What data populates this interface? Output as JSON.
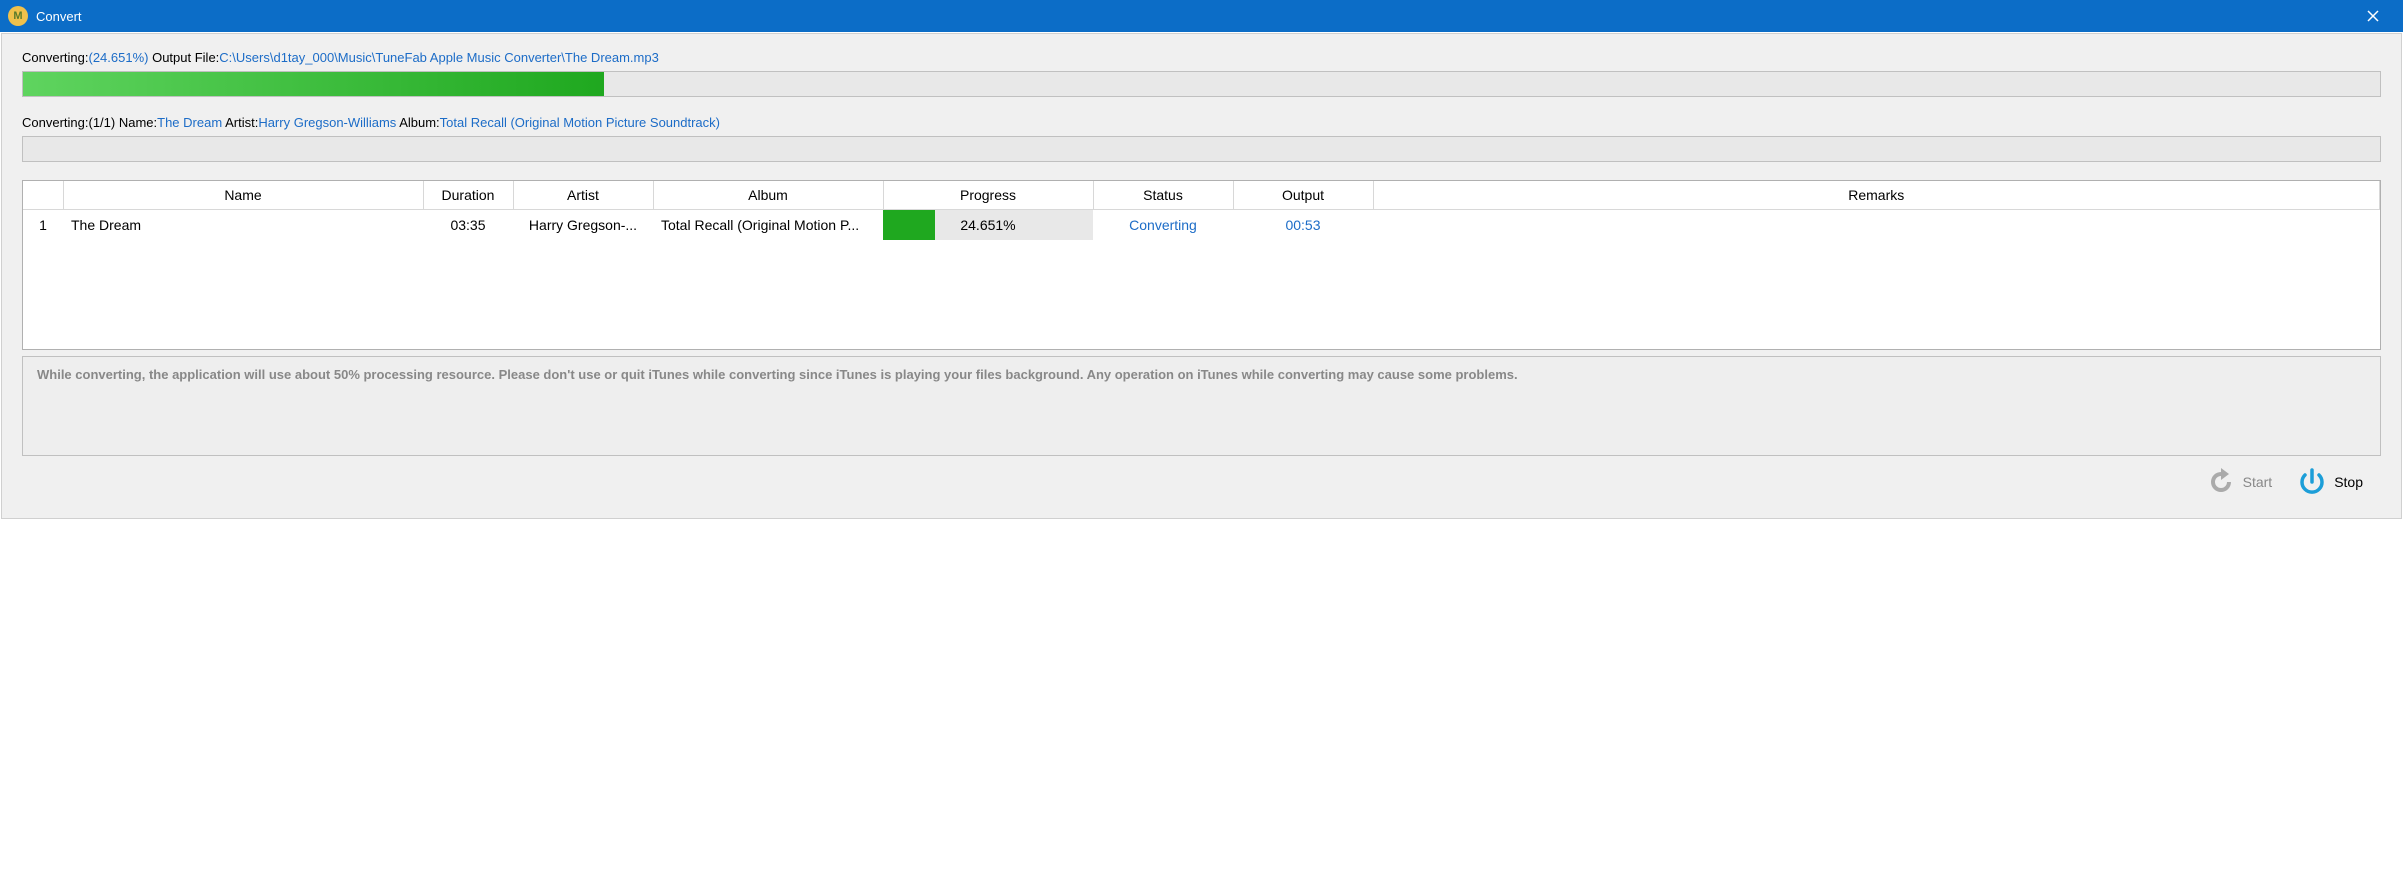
{
  "window": {
    "title": "Convert"
  },
  "top": {
    "label": "Converting:",
    "percent": "(24.651%)",
    "output_label": "Output File:",
    "output_file": "C:\\Users\\d1tay_000\\Music\\TuneFab Apple Music Converter\\The Dream.mp3",
    "progress_percent": 24.651
  },
  "track": {
    "label": "Converting:",
    "index": "(1/1)",
    "name_label": "Name:",
    "name": "The Dream",
    "artist_label": "Artist:",
    "artist": "Harry Gregson-Williams",
    "album_label": "Album:",
    "album": "Total Recall (Original Motion Picture Soundtrack)",
    "progress_percent": 0
  },
  "table": {
    "headers": {
      "idx": "",
      "name": "Name",
      "duration": "Duration",
      "artist": "Artist",
      "album": "Album",
      "progress": "Progress",
      "status": "Status",
      "output": "Output",
      "remarks": "Remarks"
    },
    "rows": [
      {
        "idx": "1",
        "name": "The Dream",
        "duration": "03:35",
        "artist": "Harry Gregson-...",
        "album": "Total Recall (Original Motion P...",
        "progress_text": "24.651%",
        "progress_percent": 24.651,
        "status": "Converting",
        "output": "00:53",
        "remarks": ""
      }
    ]
  },
  "note": "While converting, the application will use about 50% processing resource. Please don't use or quit iTunes while converting since iTunes is playing your files background. Any operation on iTunes while converting may cause some problems.",
  "footer": {
    "start": "Start",
    "stop": "Stop"
  }
}
